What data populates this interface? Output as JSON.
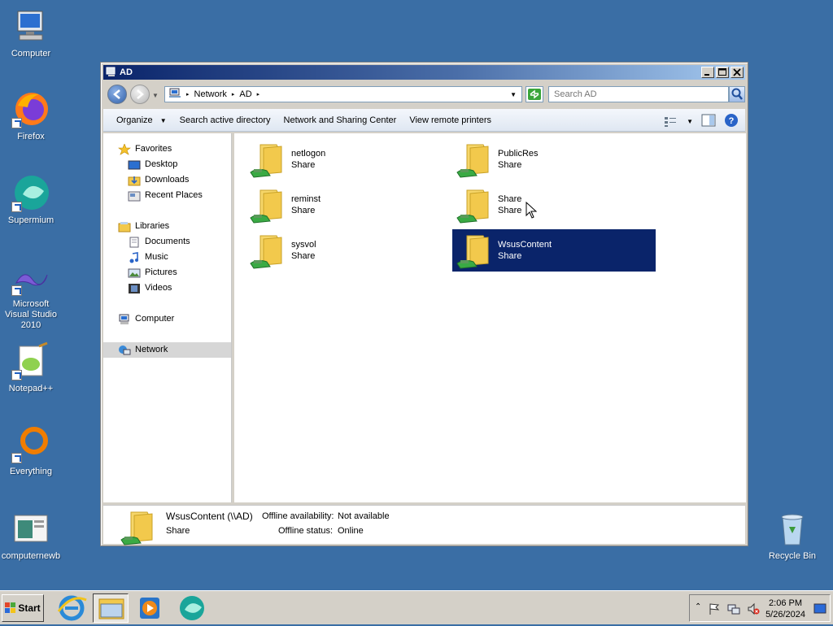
{
  "desktop": {
    "icons": [
      {
        "label": "Computer",
        "icon": "computer-icon"
      },
      {
        "label": "Firefox",
        "icon": "firefox-icon"
      },
      {
        "label": "Supermium",
        "icon": "supermium-icon"
      },
      {
        "label": "Microsoft Visual Studio 2010",
        "icon": "visual-studio-icon"
      },
      {
        "label": "Notepad++",
        "icon": "notepadpp-icon"
      },
      {
        "label": "Everything",
        "icon": "everything-icon"
      },
      {
        "label": "computernewb",
        "icon": "computernewb-icon"
      },
      {
        "label": "Recycle Bin",
        "icon": "recycle-bin-icon"
      }
    ]
  },
  "window": {
    "title": "AD",
    "address": {
      "crumbs": [
        "Network",
        "AD"
      ]
    },
    "search": {
      "placeholder": "Search AD"
    },
    "toolbar": {
      "organize": "Organize",
      "search_ad": "Search active directory",
      "network_center": "Network and Sharing Center",
      "remote_printers": "View remote printers"
    },
    "nav": {
      "favorites": "Favorites",
      "desktop": "Desktop",
      "downloads": "Downloads",
      "recent": "Recent Places",
      "libraries": "Libraries",
      "documents": "Documents",
      "music": "Music",
      "pictures": "Pictures",
      "videos": "Videos",
      "computer": "Computer",
      "network": "Network"
    },
    "items": [
      {
        "name": "netlogon",
        "type": "Share"
      },
      {
        "name": "PublicRes",
        "type": "Share"
      },
      {
        "name": "reminst",
        "type": "Share"
      },
      {
        "name": "Share",
        "type": "Share"
      },
      {
        "name": "sysvol",
        "type": "Share"
      },
      {
        "name": "WsusContent",
        "type": "Share"
      }
    ],
    "details": {
      "name": "WsusContent (\\\\AD)",
      "type": "Share",
      "offline_availability_label": "Offline availability:",
      "offline_availability_value": "Not available",
      "offline_status_label": "Offline status:",
      "offline_status_value": "Online"
    }
  },
  "taskbar": {
    "start_label": "Start",
    "clock_time": "2:06 PM",
    "clock_date": "5/26/2024"
  },
  "colors": {
    "desktop": "#3a6ea5",
    "selection": "#0a246a",
    "folder": "#f2c94c"
  }
}
